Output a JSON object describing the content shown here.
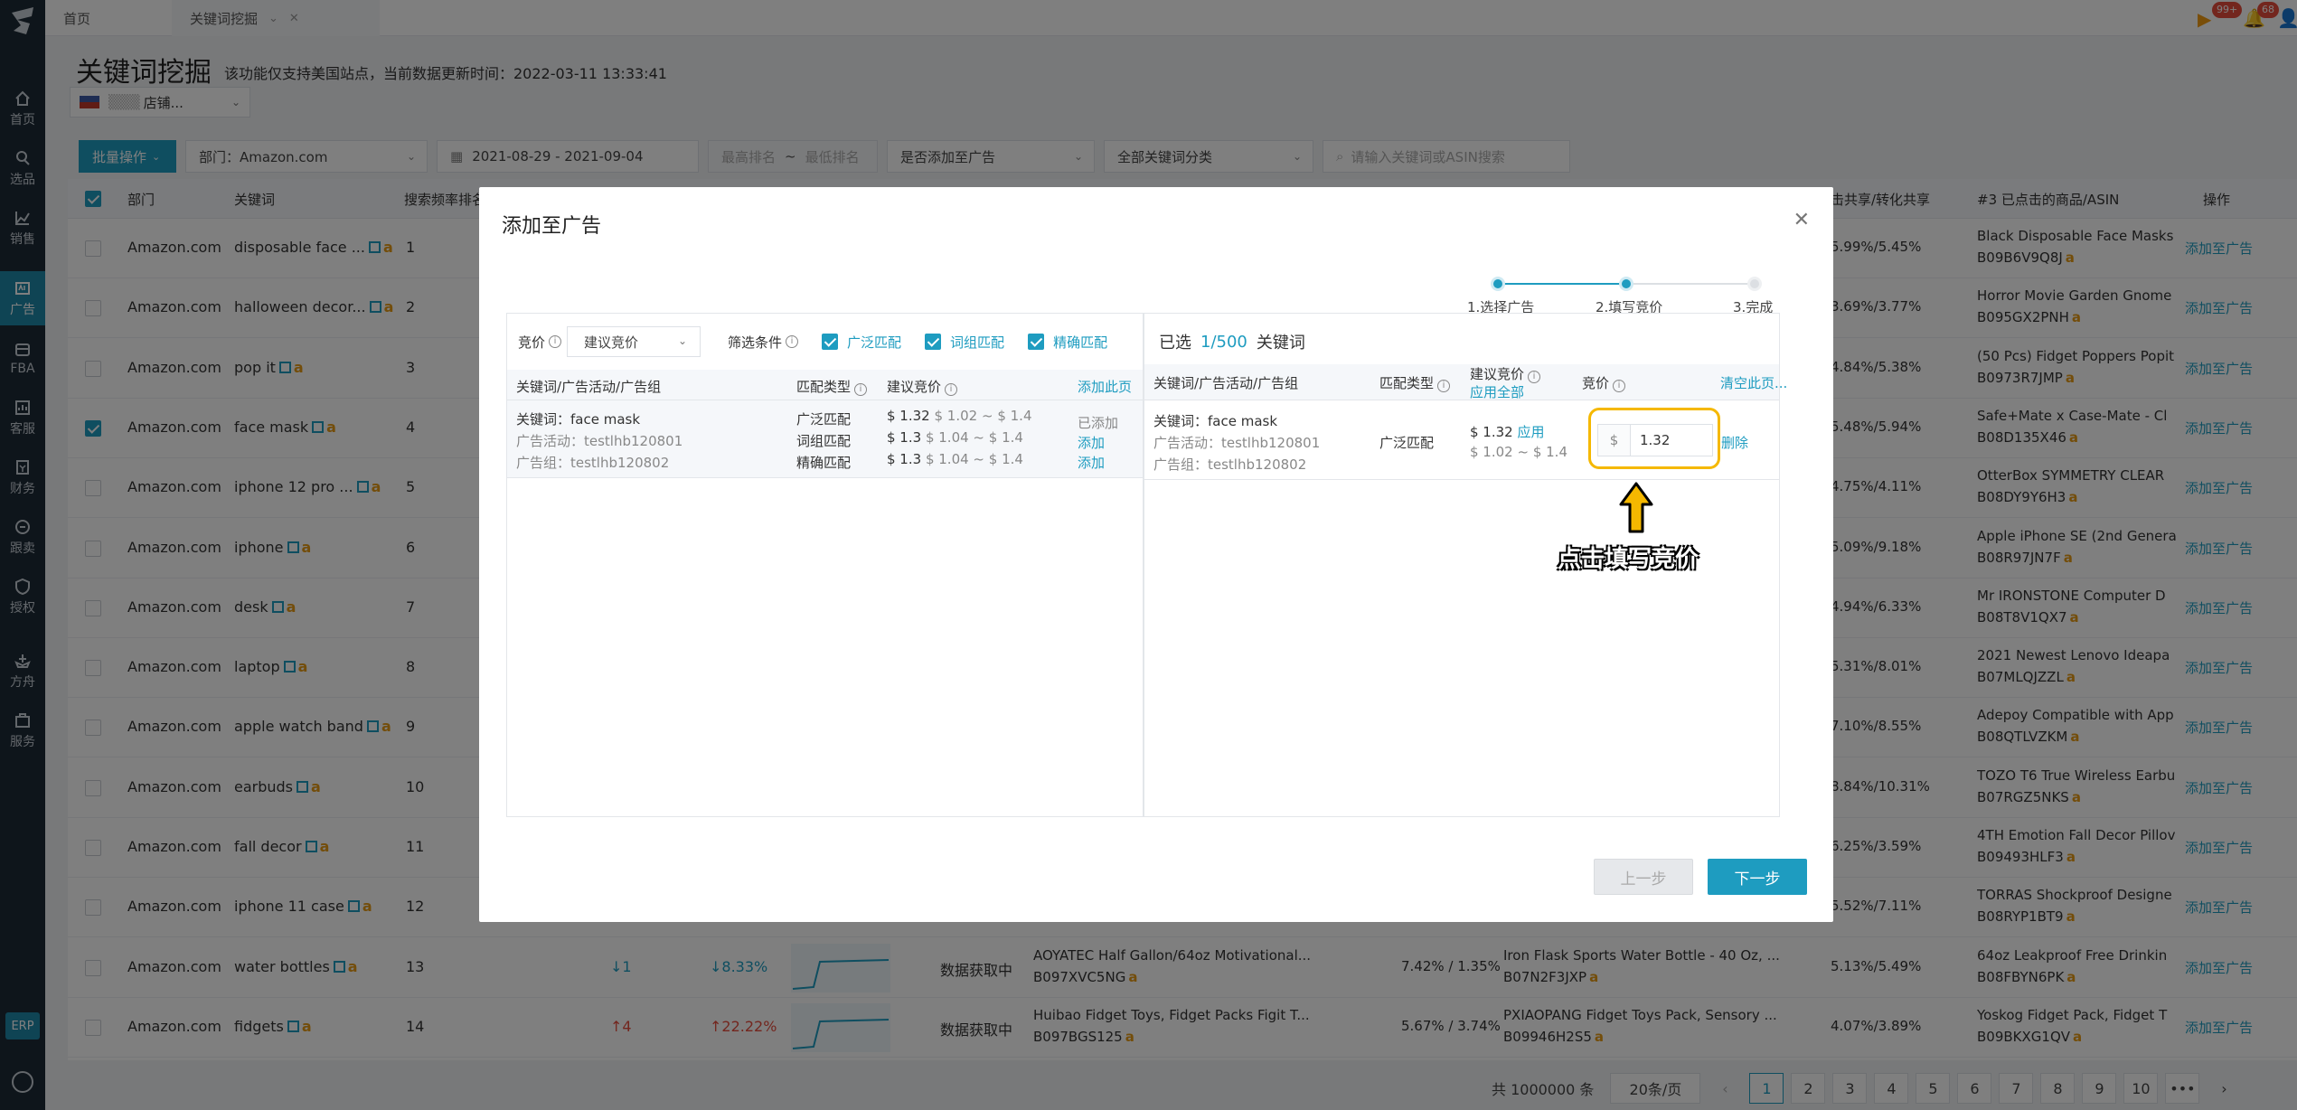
{
  "sidebar": {
    "items": [
      {
        "label": "首页",
        "icon": "home-icon"
      },
      {
        "label": "选品",
        "icon": "search-icon"
      },
      {
        "label": "销售",
        "icon": "chart-line-icon"
      },
      {
        "label": "广告",
        "icon": "ad-icon"
      },
      {
        "label": "FBA",
        "icon": "box-icon"
      },
      {
        "label": "客服",
        "icon": "service-icon"
      },
      {
        "label": "财务",
        "icon": "finance-icon"
      },
      {
        "label": "跟卖",
        "icon": "follow-icon"
      },
      {
        "label": "授权",
        "icon": "shield-icon"
      },
      {
        "label": "方舟",
        "icon": "ship-icon"
      },
      {
        "label": "服务",
        "icon": "briefcase-icon"
      }
    ],
    "erp": "ERP"
  },
  "topbar": {
    "tabs": [
      "首页",
      "关键词挖掘"
    ],
    "badges": [
      "99+",
      "68"
    ]
  },
  "page": {
    "title": "关键词挖掘",
    "note": "该功能仅支持美国站点，当前数据更新时间：2022-03-11 13:33:41",
    "store": "店铺..."
  },
  "filters": {
    "batch": "批量操作",
    "dept": "部门：Amazon.com",
    "date": "2021-08-29  -  2021-09-04",
    "rank_min": "最高排名",
    "tilde": "~",
    "rank_max": "最低排名",
    "added": "是否添加至广告",
    "category": "全部关键词分类",
    "search_placeholder": "请输入关键词或ASIN搜索"
  },
  "table": {
    "headers": {
      "dept": "部门",
      "keyword": "关键词",
      "freq": "搜索频率排名",
      "share": "击共享/转化共享",
      "asin3": "#3 已点击的商品/ASIN",
      "op": "操作"
    },
    "rows": [
      {
        "dept": "Amazon.com",
        "kw": "disposable face ...",
        "rank": "1",
        "share": "5.99%/5.45%",
        "prod": "Black Disposable Face Masks",
        "asin": "B09B6V9Q8J",
        "op": "添加至广告",
        "checked": false
      },
      {
        "dept": "Amazon.com",
        "kw": "halloween decor...",
        "rank": "2",
        "share": "3.69%/3.77%",
        "prod": "Horror Movie Garden Gnome",
        "asin": "B095GX2PNH",
        "op": "添加至广告",
        "checked": false
      },
      {
        "dept": "Amazon.com",
        "kw": "pop it",
        "rank": "3",
        "share": "4.84%/5.38%",
        "prod": "(50 Pcs) Fidget Poppers Popit",
        "asin": "B0973R7JMP",
        "op": "添加至广告",
        "checked": false
      },
      {
        "dept": "Amazon.com",
        "kw": "face mask",
        "rank": "4",
        "share": "5.48%/5.94%",
        "prod": "Safe+Mate x Case-Mate - Cl",
        "asin": "B08D135X46",
        "op": "添加至广告",
        "checked": true
      },
      {
        "dept": "Amazon.com",
        "kw": "iphone 12 pro ...",
        "rank": "5",
        "share": "4.75%/4.11%",
        "prod": "OtterBox SYMMETRY CLEAR",
        "asin": "B08DY9Y6H3",
        "op": "添加至广告",
        "checked": false
      },
      {
        "dept": "Amazon.com",
        "kw": "iphone",
        "rank": "6",
        "share": "5.09%/9.18%",
        "prod": "Apple iPhone SE (2nd Genera",
        "asin": "B08R97JN7F",
        "op": "添加至广告",
        "checked": false
      },
      {
        "dept": "Amazon.com",
        "kw": "desk",
        "rank": "7",
        "share": "4.94%/6.33%",
        "prod": "Mr IRONSTONE Computer D",
        "asin": "B08T8V1QX7",
        "op": "添加至广告",
        "checked": false
      },
      {
        "dept": "Amazon.com",
        "kw": "laptop",
        "rank": "8",
        "share": "5.31%/8.01%",
        "prod": "2021 Newest Lenovo Ideapa",
        "asin": "B07MLQJZZL",
        "op": "添加至广告",
        "checked": false
      },
      {
        "dept": "Amazon.com",
        "kw": "apple watch band",
        "rank": "9",
        "share": "7.10%/8.55%",
        "prod": "Adepoy Compatible with App",
        "asin": "B08QTLVZKM",
        "op": "添加至广告",
        "checked": false
      },
      {
        "dept": "Amazon.com",
        "kw": "earbuds",
        "rank": "10",
        "share": "8.84%/10.31%",
        "prod": "TOZO T6 True Wireless Earbu",
        "asin": "B07RGZ5NKS",
        "op": "添加至广告",
        "checked": false
      },
      {
        "dept": "Amazon.com",
        "kw": "fall decor",
        "rank": "11",
        "share": "6.25%/3.59%",
        "prod": "4TH Emotion Fall Decor Pillov",
        "asin": "B09493HLF3",
        "op": "添加至广告",
        "checked": false
      },
      {
        "dept": "Amazon.com",
        "kw": "iphone 11 case",
        "rank": "12",
        "share": "5.52%/7.11%",
        "prod": "TORRAS Shockproof Designe",
        "asin": "B08RYP1BT9",
        "op": "添加至广告",
        "checked": false
      },
      {
        "dept": "Amazon.com",
        "kw": "water bottles",
        "rank": "13",
        "change": "↓1",
        "pct": "↓8.33%",
        "status": "数据获取中",
        "p1": "AOYATEC Half Gallon/64oz Motivational...",
        "a1": "B097XVC5NG",
        "cs1": "7.42% / 1.35%",
        "p2": "Iron Flask Sports Water Bottle - 40 Oz, ...",
        "a2": "B07N2F3JXP",
        "share": "5.13%/5.49%",
        "prod": "64oz Leakproof Free Drinkin",
        "asin": "B08FBYN6PK",
        "op": "添加至广告",
        "checked": false
      },
      {
        "dept": "Amazon.com",
        "kw": "fidgets",
        "rank": "14",
        "change": "↑4",
        "pct": "↑22.22%",
        "status": "数据获取中",
        "p1": "Huibao Fidget Toys, Fidget Packs Figit T...",
        "a1": "B097BGS125",
        "cs1": "5.67% / 3.74%",
        "p2": "PXIAOPANG Fidget Toys Pack, Sensory ...",
        "a2": "B09946H2S5",
        "share": "4.07%/3.89%",
        "prod": "Yoskog Fidget Pack, Fidget T",
        "asin": "B09BKXG1QV",
        "op": "添加至广告",
        "checked": false
      }
    ]
  },
  "pager": {
    "total": "共 1000000 条",
    "size": "20条/页",
    "pages": [
      "1",
      "2",
      "3",
      "4",
      "5",
      "6",
      "7",
      "8",
      "9",
      "10",
      "•••"
    ],
    "prev": "‹",
    "next": "›"
  },
  "modal": {
    "title": "添加至广告",
    "steps": [
      "1.选择广告",
      "2.填写竞价",
      "3.完成"
    ],
    "left": {
      "bid_label": "竞价",
      "bid_select": "建议竞价",
      "filter_label": "筛选条件",
      "checks": [
        "广泛匹配",
        "词组匹配",
        "精确匹配"
      ],
      "col_kw": "关键词/广告活动/广告组",
      "col_match": "匹配类型",
      "col_bid": "建议竞价",
      "add_page": "添加此页",
      "row": {
        "kw": "关键词：face mask",
        "campaign": "广告活动：testlhb120801",
        "group": "广告组：testlhb120802",
        "matches": [
          "广泛匹配",
          "词组匹配",
          "精确匹配"
        ],
        "bids": [
          "$ 1.32",
          "$ 1.3",
          "$ 1.3"
        ],
        "ranges": [
          "$ 1.02 ~ $ 1.4",
          "$ 1.04 ~ $ 1.4",
          "$ 1.04 ~ $ 1.4"
        ],
        "actions": [
          "已添加",
          "添加",
          "添加"
        ]
      }
    },
    "right": {
      "selected_prefix": "已选",
      "count": "1/500",
      "selected_suffix": "关键词",
      "col_kw": "关键词/广告活动/广告组",
      "col_match": "匹配类型",
      "col_sbid": "建议竞价",
      "apply_all": "应用全部",
      "col_bid": "竞价",
      "clear": "清空此页...",
      "row": {
        "kw": "关键词：face mask",
        "campaign": "广告活动：testlhb120801",
        "group": "广告组：testlhb120802",
        "match": "广泛匹配",
        "sbid": "$ 1.32",
        "apply": "应用",
        "range": "$ 1.02 ~ $ 1.4",
        "currency": "$",
        "bid": "1.32",
        "delete": "删除"
      }
    },
    "annotation": "点击填写竞价",
    "prev": "上一步",
    "next": "下一步",
    "accent": "#1e9cc0",
    "highlight": "#f5b800"
  }
}
